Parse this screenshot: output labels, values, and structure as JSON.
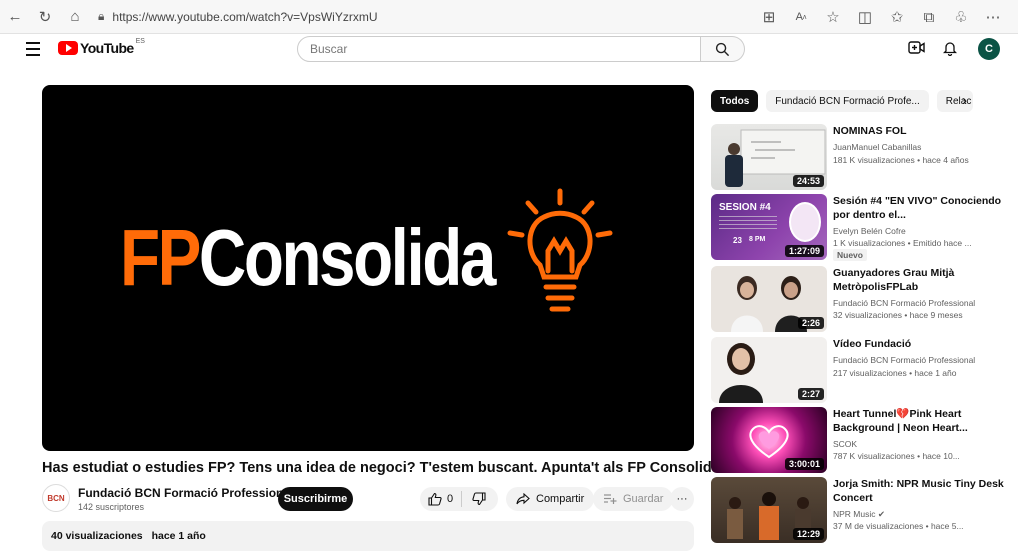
{
  "browser": {
    "url": "https://www.youtube.com/watch?v=VpsWiYzrxmU"
  },
  "header": {
    "logo_text": "YouTube",
    "country_code": "ES",
    "search_placeholder": "Buscar",
    "avatar_letter": "C"
  },
  "video": {
    "brand_fp": "FP",
    "brand_rest": "Consolida",
    "title": "Has estudiat o estudies FP? Tens una idea de negoci? T'estem buscant. Apunta't als FP Consolida.",
    "channel_name": "Fundació BCN Formació Professional",
    "channel_logo_text": "BCN",
    "subscribers": "142 suscriptores",
    "subscribe_label": "Suscribirme",
    "likes": "0",
    "share_label": "Compartir",
    "save_label": "Guardar",
    "more_label": "···",
    "views": "40 visualizaciones",
    "date": "hace 1 año"
  },
  "chips": [
    {
      "label": "Todos"
    },
    {
      "label": "Fundació BCN Formació Profe..."
    },
    {
      "label": "Relac"
    }
  ],
  "recommendations": [
    {
      "title": "NOMINAS FOL",
      "channel": "JuanManuel Cabanillas",
      "meta": "181 K visualizaciones • hace 4 años",
      "duration": "24:53",
      "badge": ""
    },
    {
      "title": "Sesión #4 \"EN VIVO\" Conociendo por dentro el...",
      "channel": "Evelyn Belén Cofre",
      "meta": "1 K visualizaciones • Emitido hace ...",
      "duration": "1:27:09",
      "badge": "Nuevo"
    },
    {
      "title": "Guanyadores Grau Mitjà MetròpolisFPLab",
      "channel": "Fundació BCN Formació Professional",
      "meta": "32 visualizaciones • hace 9 meses",
      "duration": "2:26",
      "badge": ""
    },
    {
      "title": "Vídeo Fundació",
      "channel": "Fundació BCN Formació Professional",
      "meta": "217 visualizaciones • hace 1 año",
      "duration": "2:27",
      "badge": ""
    },
    {
      "title": "Heart Tunnel💔Pink Heart Background | Neon Heart...",
      "channel": "SCOK",
      "meta": "787 K visualizaciones • hace 10...",
      "duration": "3:00:01",
      "badge": ""
    },
    {
      "title": "Jorja Smith: NPR Music Tiny Desk Concert",
      "channel": "NPR Music ✔",
      "meta": "37 M de visualizaciones • hace 5...",
      "duration": "12:29",
      "badge": ""
    }
  ],
  "thumb_texts": {
    "sesion": "SESION #4",
    "sesion_day": "23",
    "sesion_time": "8 PM"
  },
  "colors": {
    "fp_orange": "#ff6b08",
    "youtube_red": "#ff0000",
    "avatar_green": "#0b5345"
  }
}
